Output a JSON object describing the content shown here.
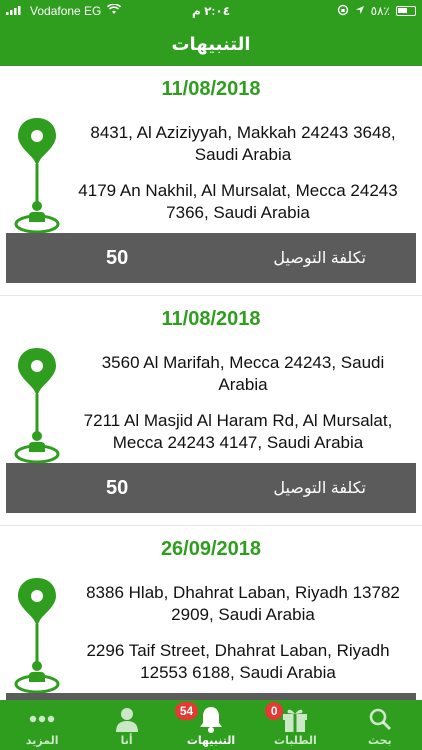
{
  "status_bar": {
    "carrier": "Vodafone EG",
    "time": "٢:٠٤ م",
    "battery": "٥٨٪"
  },
  "header": {
    "title": "التنبيهات"
  },
  "notifications": [
    {
      "date": "11/08/2018",
      "from": "8431, Al Aziziyyah, Makkah 24243 3648, Saudi Arabia",
      "to": "4179 An Nakhil, Al Mursalat, Mecca 24243 7366, Saudi Arabia",
      "fee_label": "تكلفة التوصيل",
      "fee_value": "50"
    },
    {
      "date": "11/08/2018",
      "from": "3560 Al Marifah, Mecca 24243, Saudi Arabia",
      "to": "7211 Al Masjid Al Haram Rd, Al Mursalat, Mecca 24243 4147, Saudi Arabia",
      "fee_label": "تكلفة التوصيل",
      "fee_value": "50"
    },
    {
      "date": "26/09/2018",
      "from": "8386 Hlab, Dhahrat Laban, Riyadh 13782 2909, Saudi Arabia",
      "to": "2296 Taif Street, Dhahrat Laban, Riyadh 12553 6188, Saudi Arabia",
      "fee_label": "",
      "fee_value": ""
    }
  ],
  "tabs": [
    {
      "label": "المزيد",
      "icon": "more-dots-icon"
    },
    {
      "label": "أنا",
      "icon": "person-icon"
    },
    {
      "label": "التنبيهات",
      "icon": "bell-icon",
      "badge": "54",
      "active": true
    },
    {
      "label": "الطلبات",
      "icon": "gift-icon",
      "badge": "0"
    },
    {
      "label": "بحث",
      "icon": "search-icon"
    }
  ],
  "colors": {
    "primary": "#2f9e1f",
    "fee_bar": "#5b5b5b",
    "badge": "#e53935"
  }
}
